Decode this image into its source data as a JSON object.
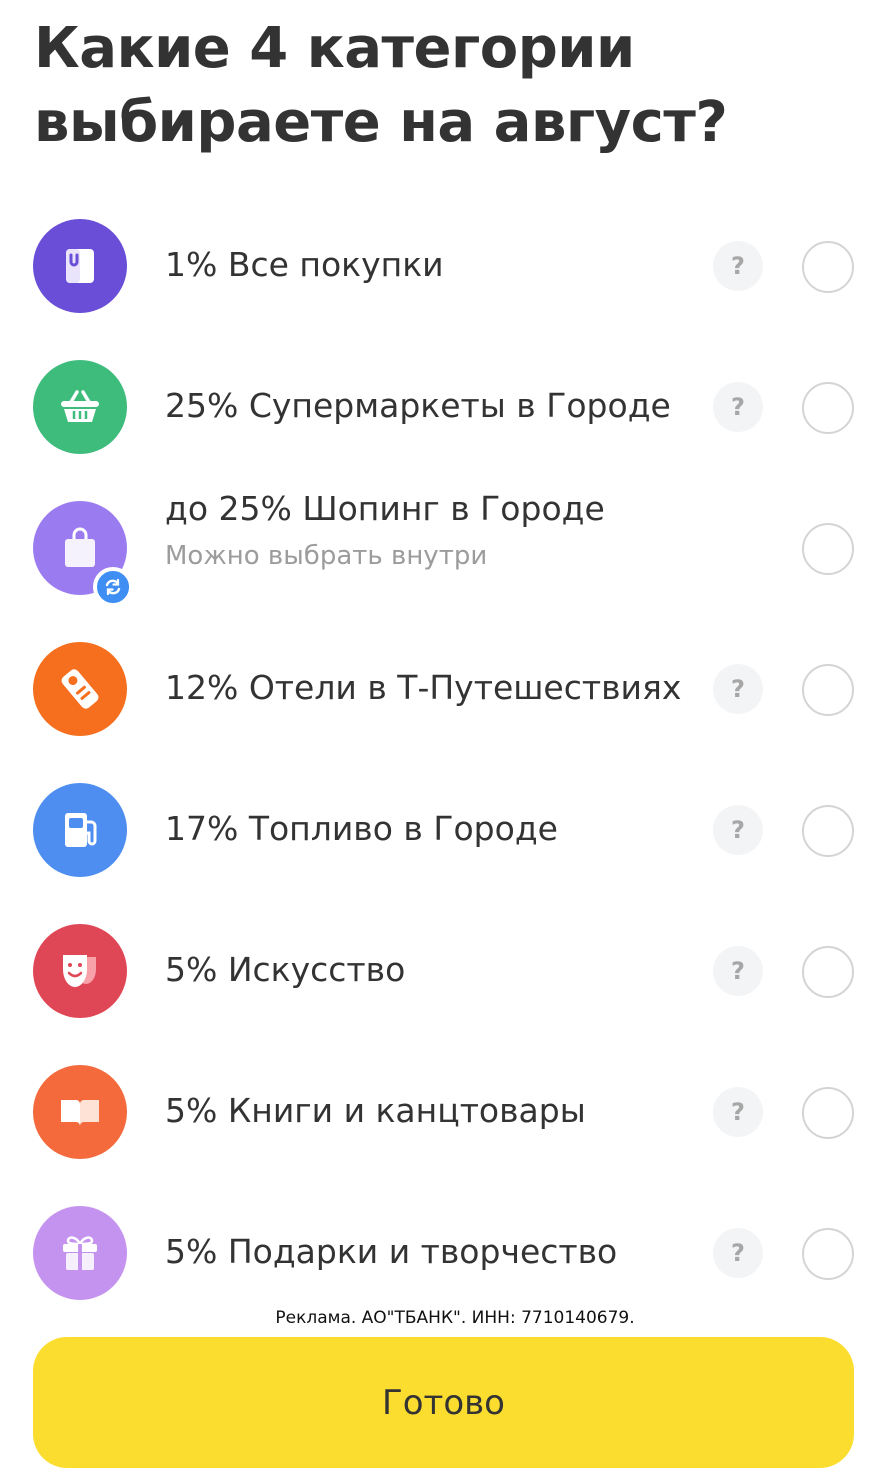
{
  "page": {
    "title": "Какие 4 категории выбираете на август?"
  },
  "categories": [
    {
      "label": "1% Все покупки",
      "icon": "shopping-bag-icon",
      "color": "#6a4ed8",
      "help": "?",
      "has_help": true
    },
    {
      "label": "25% Супермаркеты в Городе",
      "icon": "basket-icon",
      "color": "#3ebc7c",
      "help": "?",
      "has_help": true
    },
    {
      "label": "до 25% Шопинг в Городе",
      "sublabel": "Можно выбрать внутри",
      "icon": "tote-bag-icon",
      "color": "#9b7cf0",
      "badge_icon": "refresh-icon",
      "has_help": false
    },
    {
      "label": "12% Отели в Т-Путешествиях",
      "icon": "door-hanger-icon",
      "color": "#f56f1e",
      "help": "?",
      "has_help": true
    },
    {
      "label": "17% Топливо в Городе",
      "icon": "fuel-pump-icon",
      "color": "#4d8ef0",
      "help": "?",
      "has_help": true
    },
    {
      "label": "5% Искусство",
      "icon": "theater-mask-icon",
      "color": "#e04756",
      "help": "?",
      "has_help": true
    },
    {
      "label": "5% Книги и канцтовары",
      "icon": "open-book-icon",
      "color": "#f46a3c",
      "help": "?",
      "has_help": true
    },
    {
      "label": "5% Подарки и творчество",
      "icon": "gift-icon",
      "color": "#c493f0",
      "help": "?",
      "has_help": true
    }
  ],
  "footer": {
    "ad_text": "Реклама. АО\"ТБАНК\". ИНН: 7710140679.",
    "done_label": "Готово",
    "done_color": "#fbdd2f"
  }
}
